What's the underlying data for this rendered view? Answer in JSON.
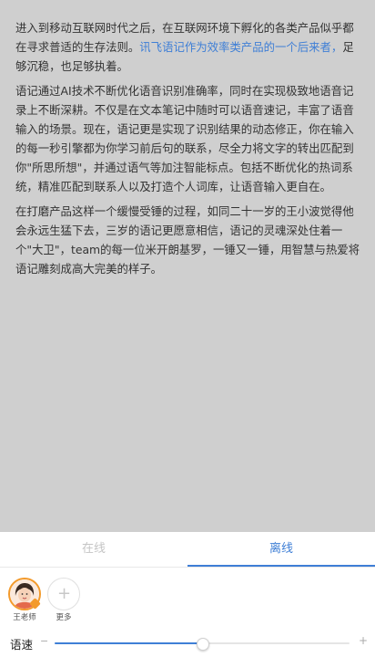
{
  "article": {
    "p1_a": "进入到移动互联网时代之后，在互联网环境下孵化的各类产品似乎都在寻求普适的生存法则。",
    "p1_link": "讯飞语记作为效率类产品的一个后来者，",
    "p1_b": "足够沉稳，也足够执着。",
    "p2": "语记通过AI技术不断优化语音识别准确率，同时在实现极致地语音记录上不断深耕。不仅是在文本笔记中随时可以语音速记，丰富了语音输入的场景。现在，语记更是实现了识别结果的动态修正，你在输入的每一秒引擎都为你学习前后句的联系，尽全力将文字的转出匹配到你\"所思所想\"，并通过语气等加注智能标点。包括不断优化的热词系统，精准匹配到联系人以及打造个人词库，让语音输入更自在。",
    "p3": "在打磨产品这样一个缓慢受锤的过程，如同二十一岁的王小波觉得他会永远生猛下去，三岁的语记更愿意相信，语记的灵魂深处住着一个\"大卫\"，team的每一位米开朗基罗，一锤又一锤，用智慧与热爱将语记雕刻成高大完美的样子。"
  },
  "tabs": [
    {
      "label": "在线",
      "active": false
    },
    {
      "label": "离线",
      "active": true
    }
  ],
  "voices": [
    {
      "name": "王老师",
      "selected": true,
      "icon": "teacher-avatar-icon"
    },
    {
      "name": "更多",
      "selected": false,
      "icon": "plus-icon"
    }
  ],
  "more_symbol": "+",
  "speed": {
    "label": "语速",
    "minus": "−",
    "plus": "+",
    "value_percent": 50
  },
  "colors": {
    "accent": "#3f7fd6",
    "badge": "#f39a2b"
  }
}
